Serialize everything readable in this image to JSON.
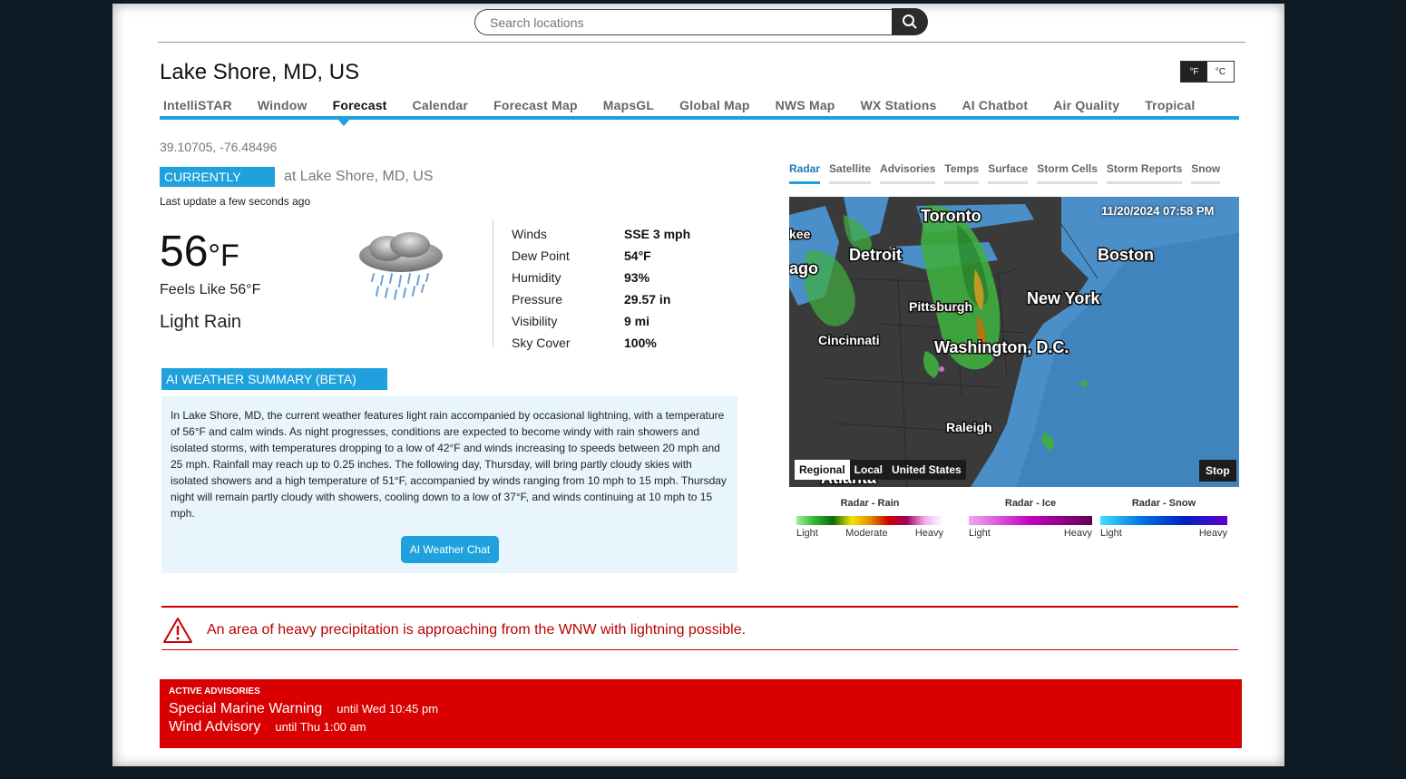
{
  "search": {
    "placeholder": "Search locations"
  },
  "location": {
    "title": "Lake Shore, MD, US",
    "coords": "39.10705, -76.48496"
  },
  "units": {
    "f": "°F",
    "c": "°C"
  },
  "nav": [
    "IntelliSTAR",
    "Window",
    "Forecast",
    "Calendar",
    "Forecast Map",
    "MapsGL",
    "Global Map",
    "NWS Map",
    "WX Stations",
    "AI Chatbot",
    "Air Quality",
    "Tropical"
  ],
  "nav_active": "Forecast",
  "current": {
    "badge": "CURRENTLY",
    "at": "at Lake Shore, MD, US",
    "last_update": "Last update a few seconds ago",
    "temp": "56",
    "temp_unit": "°F",
    "feels_like": "Feels Like 56°F",
    "condition": "Light Rain",
    "icon": "rain-cloud-icon"
  },
  "stats": [
    {
      "label": "Winds",
      "value": "SSE 3 mph"
    },
    {
      "label": "Dew Point",
      "value": "54°F"
    },
    {
      "label": "Humidity",
      "value": "93%"
    },
    {
      "label": "Pressure",
      "value": "29.57 in"
    },
    {
      "label": "Visibility",
      "value": "9 mi"
    },
    {
      "label": "Sky Cover",
      "value": "100%"
    }
  ],
  "ai": {
    "heading": "AI WEATHER SUMMARY (BETA)",
    "text": "In Lake Shore, MD, the current weather features light rain accompanied by occasional lightning, with a temperature of 56°F and calm winds. As night progresses, conditions are expected to become windy with rain showers and isolated storms, with temperatures dropping to a low of 42°F and winds increasing to speeds between 20 mph and 25 mph. Rainfall may reach up to 0.25 inches. The following day, Thursday, will bring partly cloudy skies with isolated showers and a high temperature of 51°F, accompanied by winds ranging from 10 mph to 15 mph. Thursday night will remain partly cloudy with showers, cooling down to a low of 37°F, and winds continuing at 10 mph to 15 mph.",
    "button": "AI Weather Chat"
  },
  "radar": {
    "tabs": [
      "Radar",
      "Satellite",
      "Advisories",
      "Temps",
      "Surface",
      "Storm Cells",
      "Storm Reports",
      "Snow"
    ],
    "active_tab": "Radar",
    "timestamp": "11/20/2024 07:58 PM",
    "cities": [
      "Toronto",
      "Detroit",
      "Boston",
      "New York",
      "Pittsburgh",
      "Cincinnati",
      "Washington, D.C.",
      "Raleigh",
      "kee",
      "ago",
      "Atlanta"
    ],
    "scope_buttons": [
      "Regional",
      "Local",
      "United States"
    ],
    "scope_active": "Regional",
    "stop": "Stop",
    "legends": [
      {
        "title": "Radar - Rain",
        "labels": [
          "Light",
          "Moderate",
          "Heavy"
        ]
      },
      {
        "title": "Radar - Ice",
        "labels": [
          "Light",
          "Heavy"
        ]
      },
      {
        "title": "Radar - Snow",
        "labels": [
          "Light",
          "Heavy"
        ]
      }
    ]
  },
  "alert": {
    "text": "An area of heavy precipitation is approaching from the WNW with lightning possible.",
    "color": "#b00000"
  },
  "advisories": {
    "heading": "ACTIVE ADVISORIES",
    "items": [
      {
        "name": "Special Marine Warning",
        "until": "until Wed 10:45 pm"
      },
      {
        "name": "Wind Advisory",
        "until": "until Thu 1:00 am"
      }
    ],
    "color": "#d80000"
  },
  "colors": {
    "accent": "#1ea1dc",
    "alert": "#c00000"
  }
}
